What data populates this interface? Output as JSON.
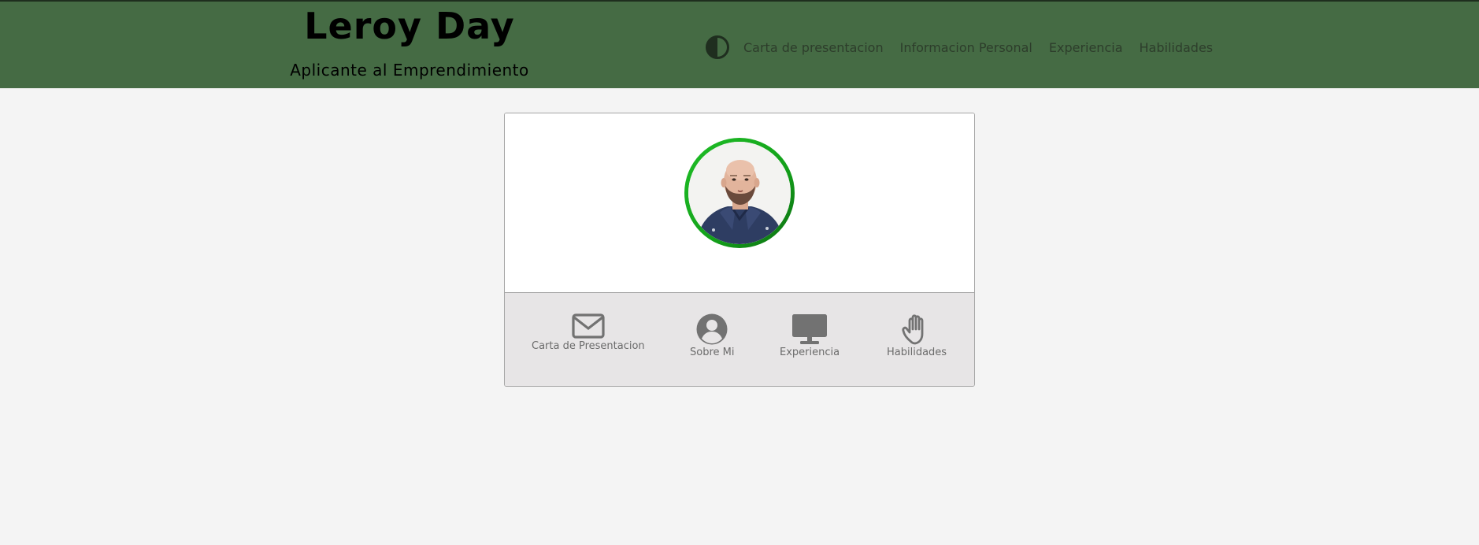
{
  "header": {
    "name": "Leroy Day",
    "subtitle": "Aplicante al Emprendimiento",
    "background_color": "#456b44"
  },
  "nav": {
    "theme_toggle_icon": "contrast-icon",
    "links": [
      {
        "label": "Carta de presentacion"
      },
      {
        "label": "Informacion Personal"
      },
      {
        "label": "Experiencia"
      },
      {
        "label": "Habilidades"
      }
    ]
  },
  "profile": {
    "avatar_description_icon": "profile-photo",
    "ring_color": "#1fbf27"
  },
  "features": [
    {
      "label": "Carta de Presentacion",
      "icon": "envelope-icon"
    },
    {
      "label": "Sobre Mi",
      "icon": "user-circle-icon"
    },
    {
      "label": "Experiencia",
      "icon": "monitor-icon"
    },
    {
      "label": "Habilidades",
      "icon": "hand-icon"
    }
  ]
}
